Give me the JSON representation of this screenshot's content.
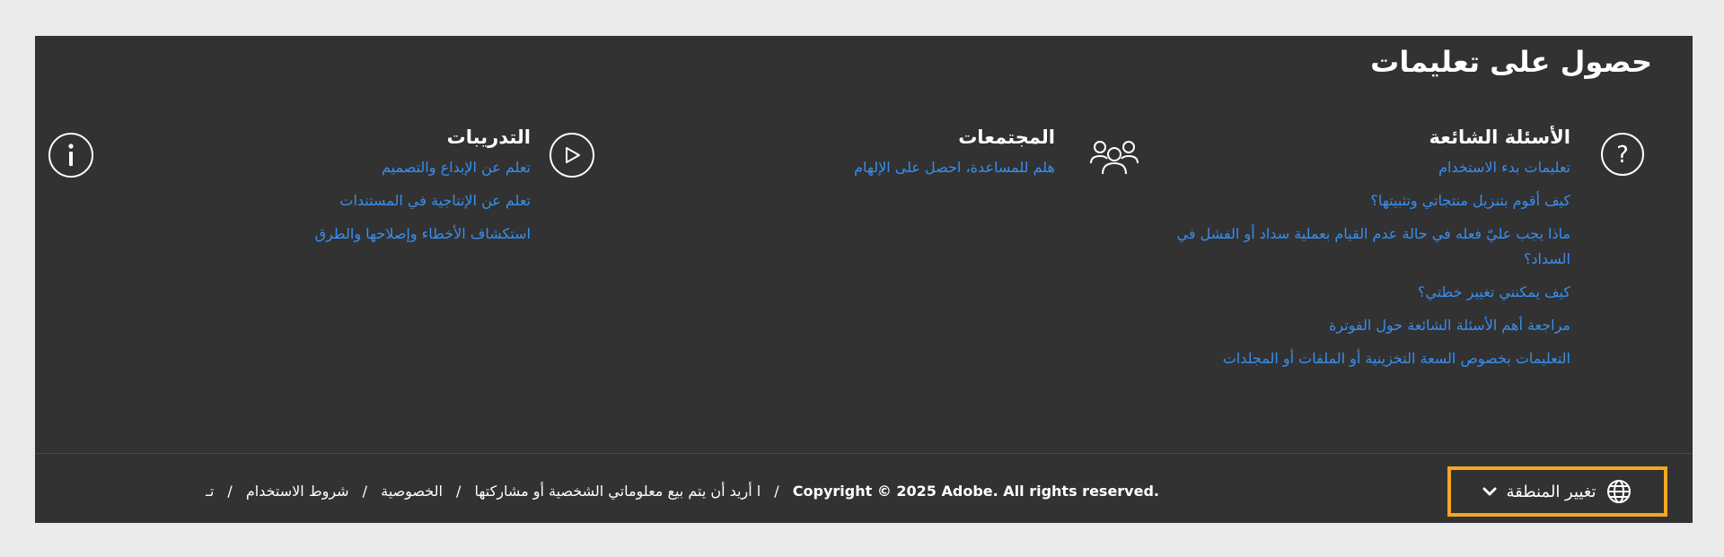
{
  "help": {
    "title": "حصول على تعليمات",
    "faq": {
      "heading": "الأسئلة الشائعة",
      "links": [
        "تعليمات بدء الاستخدام",
        "كيف أقوم بتنزيل منتجاتي وتثبيتها؟",
        "ماذا يجب عليّ فعله في حالة عدم القيام بعملية سداد أو الفشل في السداد؟",
        "كيف يمكنني تغيير خطتي؟",
        "مراجعة أهم الأسئلة الشائعة حول الفوترة",
        "التعليمات بخصوص السعة التخزينية أو الملفات أو المجلدات"
      ]
    },
    "communities": {
      "heading": "المجتمعات",
      "links": [
        "هلم للمساعدة، احصل على الإلهام"
      ]
    },
    "tutorials": {
      "heading": "التدريبات",
      "links": [
        "تعلم عن الإبداع والتصميم",
        "تعلم عن الإنتاجية في المستندات",
        "استكشاف الأخطاء وإصلاحها والطرق"
      ]
    }
  },
  "footer": {
    "region_label": "تغيير المنطقة",
    "links": [
      "تـ",
      "شروط الاستخدام",
      "الخصوصية",
      "ا أريد أن يتم بيع معلوماتي الشخصية أو مشاركتها"
    ],
    "separator": "/",
    "copyright": "Copyright © 2025 Adobe. All rights reserved."
  },
  "colors": {
    "panel": "#323232",
    "link": "#378ef0",
    "focus_ring": "#f5a623"
  },
  "icons": {
    "faq": "question-mark-circle",
    "communities": "people-group",
    "tutorials": "play-circle",
    "info": "info-circle",
    "region": "globe",
    "chevron": "chevron-down"
  }
}
